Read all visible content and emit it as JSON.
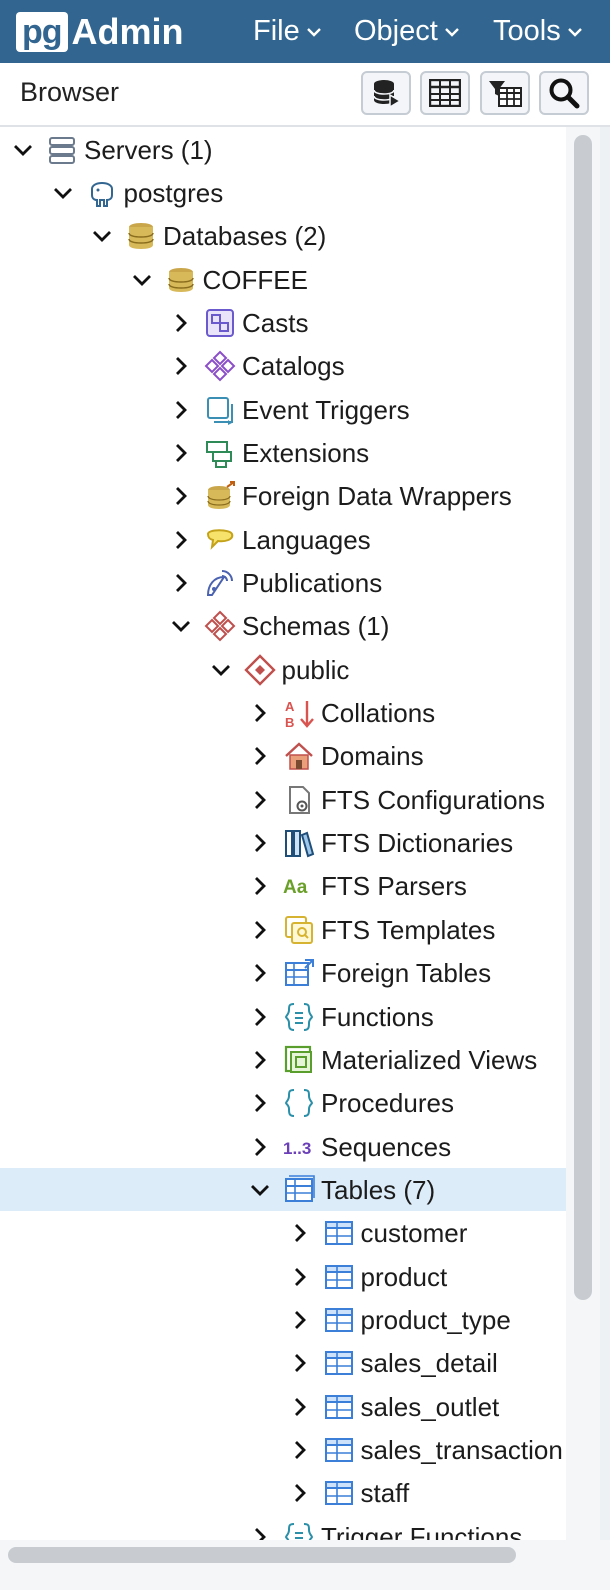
{
  "app": {
    "logo_pg": "pg",
    "logo_admin": "Admin"
  },
  "menu": [
    {
      "label": "File"
    },
    {
      "label": "Object"
    },
    {
      "label": "Tools"
    }
  ],
  "browser": {
    "title": "Browser"
  },
  "toolbar": [
    {
      "icon": "query-tool-icon"
    },
    {
      "icon": "view-data-icon"
    },
    {
      "icon": "filtered-rows-icon"
    },
    {
      "icon": "search-icon"
    }
  ],
  "tree": [
    {
      "label": "Servers (1)",
      "depth": 0,
      "expanded": true,
      "icon": "servers-icon"
    },
    {
      "label": "postgres",
      "depth": 1,
      "expanded": true,
      "icon": "postgres-elephant-icon"
    },
    {
      "label": "Databases (2)",
      "depth": 2,
      "expanded": true,
      "icon": "databases-icon"
    },
    {
      "label": "COFFEE",
      "depth": 3,
      "expanded": true,
      "icon": "database-icon"
    },
    {
      "label": "Casts",
      "depth": 4,
      "expanded": false,
      "icon": "casts-icon"
    },
    {
      "label": "Catalogs",
      "depth": 4,
      "expanded": false,
      "icon": "catalogs-icon"
    },
    {
      "label": "Event Triggers",
      "depth": 4,
      "expanded": false,
      "icon": "event-triggers-icon"
    },
    {
      "label": "Extensions",
      "depth": 4,
      "expanded": false,
      "icon": "extensions-icon"
    },
    {
      "label": "Foreign Data Wrappers",
      "depth": 4,
      "expanded": false,
      "icon": "foreign-data-wrappers-icon"
    },
    {
      "label": "Languages",
      "depth": 4,
      "expanded": false,
      "icon": "languages-icon"
    },
    {
      "label": "Publications",
      "depth": 4,
      "expanded": false,
      "icon": "publications-icon"
    },
    {
      "label": "Schemas (1)",
      "depth": 4,
      "expanded": true,
      "icon": "schemas-icon"
    },
    {
      "label": "public",
      "depth": 5,
      "expanded": true,
      "icon": "schema-icon"
    },
    {
      "label": "Collations",
      "depth": 6,
      "expanded": false,
      "icon": "collations-icon"
    },
    {
      "label": "Domains",
      "depth": 6,
      "expanded": false,
      "icon": "domains-icon"
    },
    {
      "label": "FTS Configurations",
      "depth": 6,
      "expanded": false,
      "icon": "fts-configurations-icon"
    },
    {
      "label": "FTS Dictionaries",
      "depth": 6,
      "expanded": false,
      "icon": "fts-dictionaries-icon"
    },
    {
      "label": "FTS Parsers",
      "depth": 6,
      "expanded": false,
      "icon": "fts-parsers-icon"
    },
    {
      "label": "FTS Templates",
      "depth": 6,
      "expanded": false,
      "icon": "fts-templates-icon"
    },
    {
      "label": "Foreign Tables",
      "depth": 6,
      "expanded": false,
      "icon": "foreign-tables-icon"
    },
    {
      "label": "Functions",
      "depth": 6,
      "expanded": false,
      "icon": "functions-icon"
    },
    {
      "label": "Materialized Views",
      "depth": 6,
      "expanded": false,
      "icon": "materialized-views-icon"
    },
    {
      "label": "Procedures",
      "depth": 6,
      "expanded": false,
      "icon": "procedures-icon"
    },
    {
      "label": "Sequences",
      "depth": 6,
      "expanded": false,
      "icon": "sequences-icon"
    },
    {
      "label": "Tables (7)",
      "depth": 6,
      "expanded": true,
      "icon": "tables-icon",
      "selected": true
    },
    {
      "label": "customer",
      "depth": 7,
      "expanded": false,
      "icon": "table-icon"
    },
    {
      "label": "product",
      "depth": 7,
      "expanded": false,
      "icon": "table-icon"
    },
    {
      "label": "product_type",
      "depth": 7,
      "expanded": false,
      "icon": "table-icon"
    },
    {
      "label": "sales_detail",
      "depth": 7,
      "expanded": false,
      "icon": "table-icon"
    },
    {
      "label": "sales_outlet",
      "depth": 7,
      "expanded": false,
      "icon": "table-icon"
    },
    {
      "label": "sales_transaction",
      "depth": 7,
      "expanded": false,
      "icon": "table-icon"
    },
    {
      "label": "staff",
      "depth": 7,
      "expanded": false,
      "icon": "table-icon"
    },
    {
      "label": "Trigger Functions",
      "depth": 6,
      "expanded": false,
      "icon": "trigger-functions-icon"
    }
  ],
  "colors": {
    "header": "#326690",
    "selected_row": "#dcecf9"
  }
}
